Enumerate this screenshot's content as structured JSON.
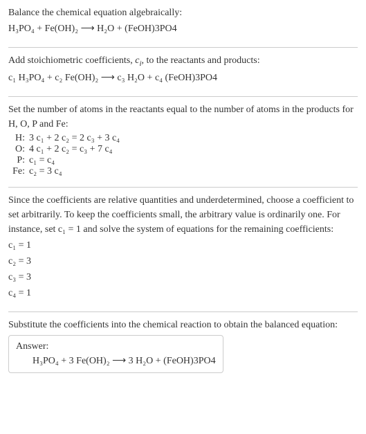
{
  "sec1": {
    "title": "Balance the chemical equation algebraically:",
    "eqn": "H₃PO₄ + Fe(OH)₂ ⟶ H₂O + (FeOH)3PO4"
  },
  "sec2": {
    "title_a": "Add stoichiometric coefficients, ",
    "title_ci": "c",
    "title_i": "i",
    "title_b": ", to the reactants and products:",
    "eqn": "c₁ H₃PO₄ + c₂ Fe(OH)₂ ⟶ c₃ H₂O + c₄ (FeOH)3PO4"
  },
  "sec3": {
    "title": "Set the number of atoms in the reactants equal to the number of atoms in the products for H, O, P and Fe:",
    "rows": [
      {
        "label": "H:",
        "eq": "3 c₁ + 2 c₂ = 2 c₃ + 3 c₄"
      },
      {
        "label": "O:",
        "eq": "4 c₁ + 2 c₂ = c₃ + 7 c₄"
      },
      {
        "label": "P:",
        "eq": "c₁ = c₄"
      },
      {
        "label": "Fe:",
        "eq": "c₂ = 3 c₄"
      }
    ]
  },
  "sec4": {
    "text": "Since the coefficients are relative quantities and underdetermined, choose a coefficient to set arbitrarily. To keep the coefficients small, the arbitrary value is ordinarily one. For instance, set c₁ = 1 and solve the system of equations for the remaining coefficients:",
    "rows": [
      "c₁ = 1",
      "c₂ = 3",
      "c₃ = 3",
      "c₄ = 1"
    ]
  },
  "sec5": {
    "title": "Substitute the coefficients into the chemical reaction to obtain the balanced equation:",
    "answer_label": "Answer:",
    "answer_eqn": "H₃PO₄ + 3 Fe(OH)₂ ⟶ 3 H₂O + (FeOH)3PO4"
  }
}
